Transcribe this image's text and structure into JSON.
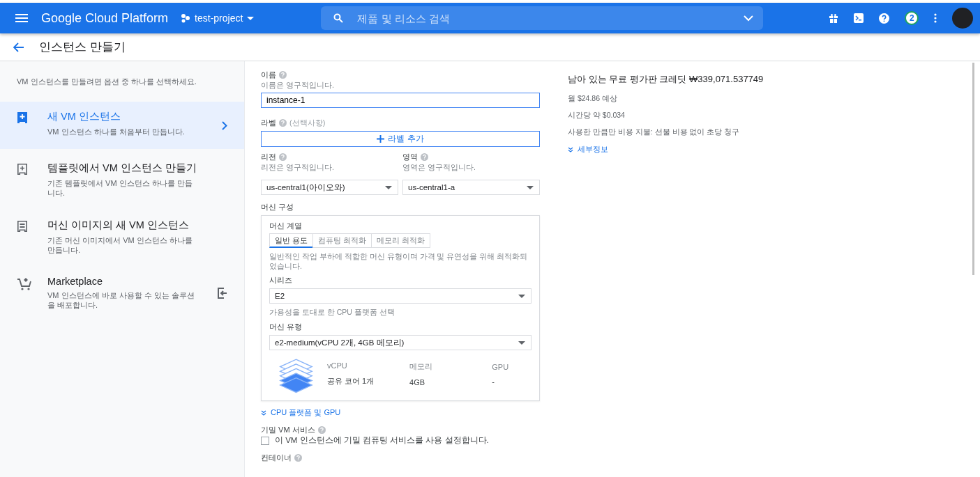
{
  "topbar": {
    "title": "Google Cloud Platform",
    "project": "test-project",
    "search": {
      "placeholder": "제품 및 리소스 검색"
    },
    "notifications": "2"
  },
  "page": {
    "title": "인스턴스 만들기"
  },
  "sidebar": {
    "intro": "VM 인스턴스를 만들려면 옵션 중 하나를 선택하세요.",
    "items": [
      {
        "kind": "new",
        "title": "새 VM 인스턴스",
        "desc": "VM 인스턴스 하나를 처음부터 만듭니다.",
        "selected": true
      },
      {
        "kind": "template",
        "title": "템플릿에서 VM 인스턴스 만들기",
        "desc": "기존 템플릿에서 VM 인스턴스 하나를 만듭니다.",
        "selected": false
      },
      {
        "kind": "image",
        "title": "머신 이미지의 새 VM 인스턴스",
        "desc": "기존 머신 이미지에서 VM 인스턴스 하나를 만듭니다.",
        "selected": false
      },
      {
        "kind": "marketplace",
        "title": "Marketplace",
        "desc": "VM 인스턴스에 바로 사용할 수 있는 솔루션을 배포합니다.",
        "selected": false
      }
    ]
  },
  "form": {
    "name": {
      "label": "이름",
      "hint": "이름은 영구적입니다.",
      "value": "instance-1"
    },
    "labels": {
      "label": "라벨",
      "optional": "(선택사항)",
      "button": "라벨 추가"
    },
    "region": {
      "label": "리전",
      "hint": "리전은 영구적입니다.",
      "value": "us-central1(아이오와)"
    },
    "zone": {
      "label": "영역",
      "hint": "영역은 영구적입니다.",
      "value": "us-central1-a"
    },
    "machine": {
      "label": "머신 구성",
      "family_label": "머신 계열",
      "tabs": [
        {
          "label": "일반 용도",
          "selected": true
        },
        {
          "label": "컴퓨팅 최적화",
          "selected": false
        },
        {
          "label": "메모리 최적화",
          "selected": false
        }
      ],
      "family_desc": "일반적인 작업 부하에 적합한 머신 유형이며 가격 및 유연성을 위해 최적화되었습니다.",
      "series_label": "시리즈",
      "series": "E2",
      "series_hint": "가용성을 토대로 한 CPU 플랫폼 선택",
      "type_label": "머신 유형",
      "type": "e2-medium(vCPU 2개, 4GB 메모리)",
      "specs": [
        {
          "head": "vCPU",
          "value": "공유 코어 1개"
        },
        {
          "head": "메모리",
          "value": "4GB"
        },
        {
          "head": "GPU",
          "value": "-"
        }
      ]
    },
    "cpu_link": "CPU 플랫폼 및 GPU",
    "confidential": {
      "label": "기밀 VM 서비스",
      "checkbox": "이 VM 인스턴스에 기밀 컴퓨팅 서비스를 사용 설정합니다.",
      "checked": false
    },
    "container": {
      "label": "컨테이너"
    }
  },
  "pricing": {
    "title": "남아 있는 무료 평가판 크레딧 ₩339,071.537749",
    "lines": [
      "월 $24.86 예상",
      "시간당 약 $0.034",
      "사용한 만큼만 비용 지불: 선불 비용 없이 초당 청구"
    ],
    "details": "세부정보"
  }
}
